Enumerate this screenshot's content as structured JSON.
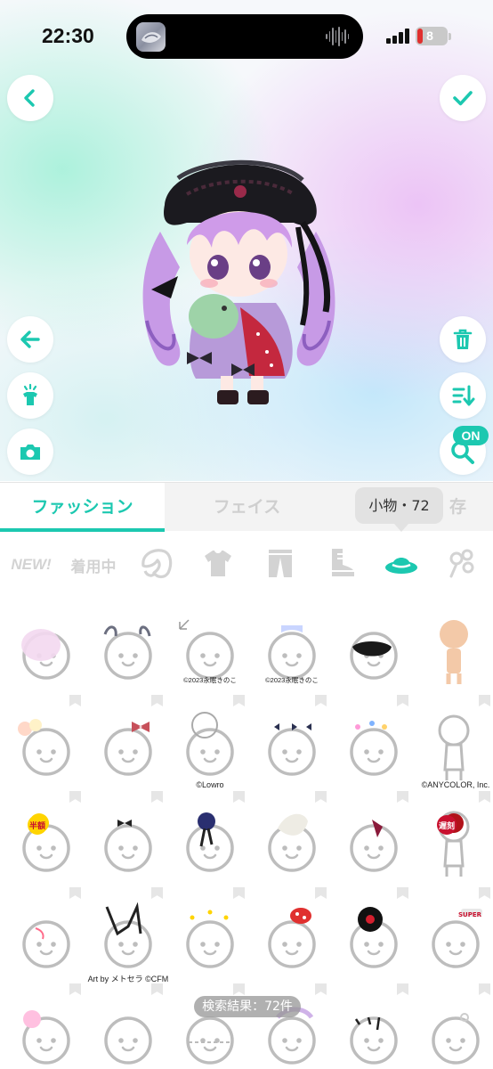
{
  "status_bar": {
    "time": "22:30",
    "battery_level": "8"
  },
  "stage": {
    "buttons": {
      "back_icon": "chevron-left-icon",
      "confirm_icon": "check-icon",
      "undo_icon": "arrow-left-icon",
      "outfit_icon": "shirt-sparkle-icon",
      "camera_icon": "camera-icon",
      "delete_icon": "trash-icon",
      "sort_icon": "sort-icon",
      "search_icon": "search-icon"
    },
    "search_toggle_label": "ON"
  },
  "tabs": [
    {
      "label": "ファッション",
      "active": true
    },
    {
      "label": "フェイス",
      "active": false
    },
    {
      "label": "",
      "active": false,
      "partial_glyph": "存"
    }
  ],
  "tooltip": {
    "text": "小物・72"
  },
  "categories": [
    {
      "label": "NEW!",
      "icon": "new-label"
    },
    {
      "label": "着用中",
      "icon": "wearing-label"
    },
    {
      "label": "",
      "icon": "hair-icon"
    },
    {
      "label": "",
      "icon": "shirt-icon"
    },
    {
      "label": "",
      "icon": "pants-icon"
    },
    {
      "label": "",
      "icon": "boot-icon"
    },
    {
      "label": "",
      "icon": "hat-icon",
      "active": true
    },
    {
      "label": "",
      "icon": "accessory-icon"
    }
  ],
  "items": [
    {
      "credit": ""
    },
    {
      "credit": ""
    },
    {
      "credit": "©2023永眠きのこ"
    },
    {
      "credit": "©2023永眠きのこ"
    },
    {
      "credit": ""
    },
    {
      "credit": ""
    },
    {
      "credit": ""
    },
    {
      "credit": ""
    },
    {
      "credit": "©Lowro"
    },
    {
      "credit": ""
    },
    {
      "credit": ""
    },
    {
      "credit": "©ANYCOLOR, Inc."
    },
    {
      "credit": "",
      "tag": "半額"
    },
    {
      "credit": ""
    },
    {
      "credit": ""
    },
    {
      "credit": ""
    },
    {
      "credit": ""
    },
    {
      "credit": "",
      "tag": "遅刻"
    },
    {
      "credit": ""
    },
    {
      "credit": "Art by メトセラ ©CFM"
    },
    {
      "credit": ""
    },
    {
      "credit": ""
    },
    {
      "credit": ""
    },
    {
      "credit": "",
      "tag": "SUPER"
    },
    {
      "credit": ""
    },
    {
      "credit": ""
    },
    {
      "credit": ""
    },
    {
      "credit": ""
    },
    {
      "credit": ""
    },
    {
      "credit": ""
    }
  ],
  "search_result": {
    "text": "検索結果：72件"
  },
  "colors": {
    "accent": "#1cc8b0",
    "inactive": "#d3d3d3"
  }
}
